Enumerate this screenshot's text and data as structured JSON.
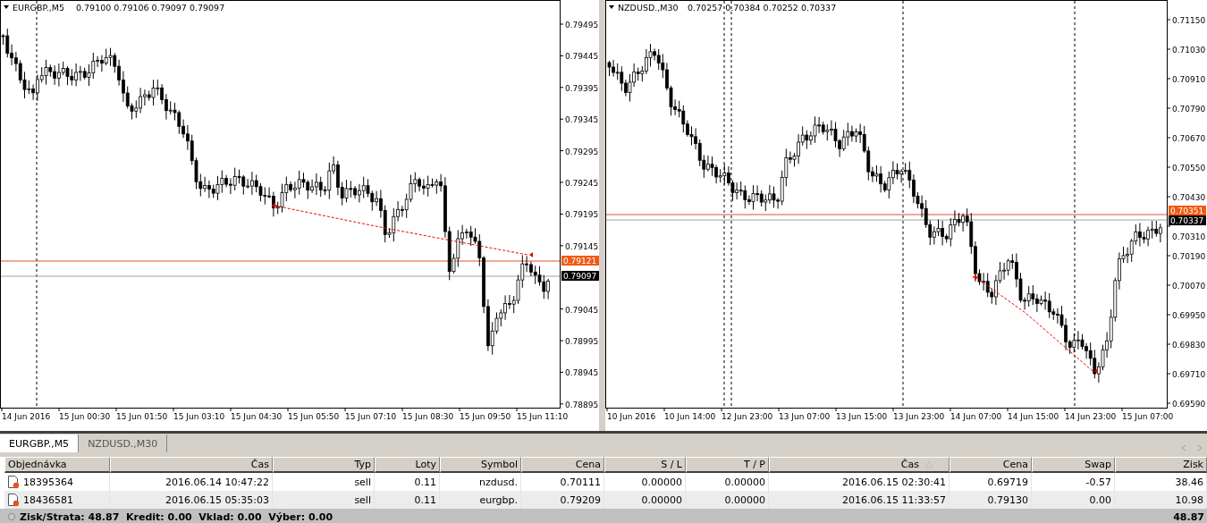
{
  "charts": [
    {
      "symbol": "EURGBP.,M5",
      "ohlc": "0.79100 0.79106 0.79097 0.79097",
      "price_labels": [
        "0.79495",
        "0.79445",
        "0.79395",
        "0.79345",
        "0.79295",
        "0.79245",
        "0.79195",
        "0.79145",
        "0.79045",
        "0.78995",
        "0.78945",
        "0.78895"
      ],
      "time_labels": [
        "14 Jun 2016",
        "15 Jun 00:30",
        "15 Jun 01:50",
        "15 Jun 03:10",
        "15 Jun 04:30",
        "15 Jun 05:50",
        "15 Jun 07:10",
        "15 Jun 08:30",
        "15 Jun 09:50",
        "15 Jun 11:10"
      ],
      "order_price": "0.79121",
      "bid_price": "0.79097"
    },
    {
      "symbol": "NZDUSD.,M30",
      "ohlc": "0.70257 0.70384 0.70252 0.70337",
      "price_labels": [
        "0.71150",
        "0.71030",
        "0.70910",
        "0.70790",
        "0.70670",
        "0.70550",
        "0.70430",
        "0.70310",
        "0.70190",
        "0.70070",
        "0.69950",
        "0.69830",
        "0.69710",
        "0.69590"
      ],
      "time_labels": [
        "10 Jun 2016",
        "10 Jun 14:00",
        "12 Jun 23:00",
        "13 Jun 07:00",
        "13 Jun 15:00",
        "13 Jun 23:00",
        "14 Jun 07:00",
        "14 Jun 15:00",
        "14 Jun 23:00",
        "15 Jun 07:00"
      ],
      "order_price": "0.70351",
      "bid_price": "0.70337"
    }
  ],
  "tabs": [
    {
      "label": "EURGBP.,M5",
      "selected": true
    },
    {
      "label": "NZDUSD.,M30",
      "selected": false
    }
  ],
  "table": {
    "columns": [
      {
        "label": "Objednávka",
        "sorted": false
      },
      {
        "label": "Čas",
        "sorted": false
      },
      {
        "label": "Typ",
        "sorted": false
      },
      {
        "label": "Loty",
        "sorted": false
      },
      {
        "label": "Symbol",
        "sorted": false
      },
      {
        "label": "Cena",
        "sorted": false
      },
      {
        "label": "S / L",
        "sorted": false
      },
      {
        "label": "T / P",
        "sorted": false
      },
      {
        "label": "Čas",
        "sorted": true
      },
      {
        "label": "Cena",
        "sorted": false
      },
      {
        "label": "Swap",
        "sorted": false
      },
      {
        "label": "Zisk",
        "sorted": false
      }
    ],
    "rows": [
      [
        "18395364",
        "2016.06.14 10:47:22",
        "sell",
        "0.11",
        "nzdusd.",
        "0.70111",
        "0.00000",
        "0.00000",
        "2016.06.15 02:30:41",
        "0.69719",
        "-0.57",
        "38.46"
      ],
      [
        "18436581",
        "2016.06.15 05:35:03",
        "sell",
        "0.11",
        "eurgbp.",
        "0.79209",
        "0.00000",
        "0.00000",
        "2016.06.15 11:33:57",
        "0.79130",
        "0.00",
        "10.98"
      ]
    ],
    "summary": "Zisk/Strata: 48.87  Kredit: 0.00  Vklad: 0.00  Výber: 0.00",
    "total": "48.87"
  }
}
